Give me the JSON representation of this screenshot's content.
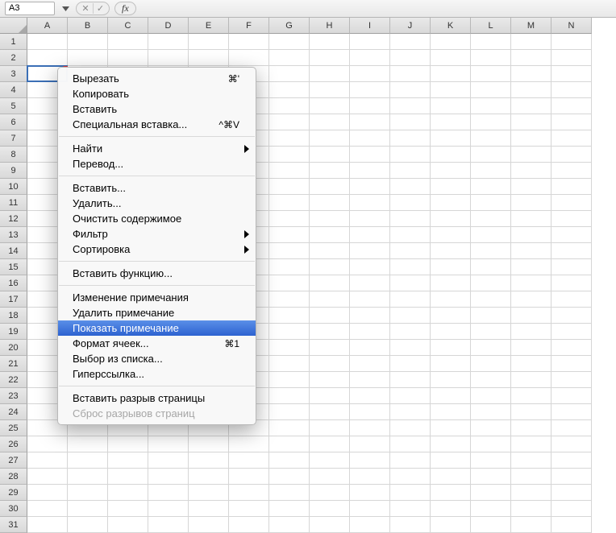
{
  "formula_bar": {
    "name_box": "A3",
    "cancel_glyph": "✕",
    "accept_glyph": "✓",
    "fx_label": "fx"
  },
  "columns": [
    "A",
    "B",
    "C",
    "D",
    "E",
    "F",
    "G",
    "H",
    "I",
    "J",
    "K",
    "L",
    "M",
    "N"
  ],
  "row_count": 31,
  "selected_cell": {
    "col": 0,
    "row": 2
  },
  "context_menu": {
    "groups": [
      [
        {
          "label": "Вырезать",
          "shortcut": "⌘'"
        },
        {
          "label": "Копировать"
        },
        {
          "label": "Вставить"
        },
        {
          "label": "Специальная вставка...",
          "shortcut": "^⌘V"
        }
      ],
      [
        {
          "label": "Найти",
          "submenu": true
        },
        {
          "label": "Перевод..."
        }
      ],
      [
        {
          "label": "Вставить..."
        },
        {
          "label": "Удалить..."
        },
        {
          "label": "Очистить содержимое"
        },
        {
          "label": "Фильтр",
          "submenu": true
        },
        {
          "label": "Сортировка",
          "submenu": true
        }
      ],
      [
        {
          "label": "Вставить функцию..."
        }
      ],
      [
        {
          "label": "Изменение примечания"
        },
        {
          "label": "Удалить примечание"
        },
        {
          "label": "Показать примечание",
          "highlight": true
        },
        {
          "label": "Формат ячеек...",
          "shortcut": "⌘1"
        },
        {
          "label": "Выбор из списка..."
        },
        {
          "label": "Гиперссылка..."
        }
      ],
      [
        {
          "label": "Вставить разрыв страницы"
        },
        {
          "label": "Сброс разрывов страниц",
          "disabled": true
        }
      ]
    ]
  }
}
